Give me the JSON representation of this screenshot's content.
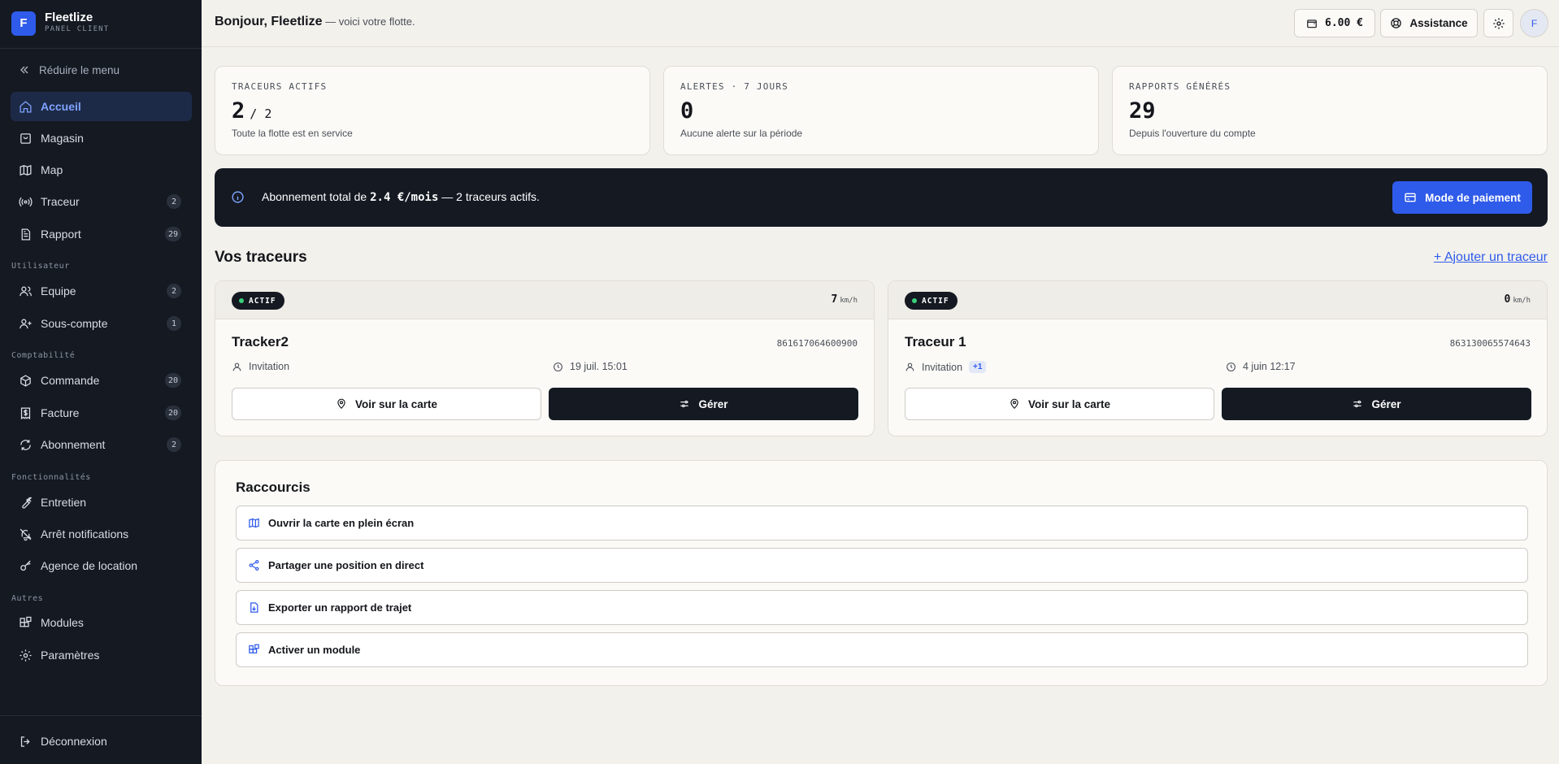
{
  "brand": {
    "logo_letter": "F",
    "name": "Fleetlize",
    "subtitle": "PANEL CLIENT"
  },
  "sidebar": {
    "collapse_label": "Réduire le menu",
    "main_items": [
      {
        "label": "Accueil",
        "icon": "home-icon",
        "active": true
      },
      {
        "label": "Magasin",
        "icon": "shopping-bag-icon"
      },
      {
        "label": "Map",
        "icon": "map-icon"
      },
      {
        "label": "Traceur",
        "icon": "radio-signal-icon",
        "badge": "2"
      },
      {
        "label": "Rapport",
        "icon": "file-text-icon",
        "badge": "29"
      }
    ],
    "sections": {
      "utilisateur": "Utilisateur",
      "comptabilite": "Comptabilité",
      "fonctionnalites": "Fonctionnalités",
      "autres": "Autres"
    },
    "user_items": [
      {
        "label": "Equipe",
        "icon": "users-icon",
        "badge": "2"
      },
      {
        "label": "Sous-compte",
        "icon": "user-plus-icon",
        "badge": "1"
      }
    ],
    "accounting_items": [
      {
        "label": "Commande",
        "icon": "package-icon",
        "badge": "20"
      },
      {
        "label": "Facture",
        "icon": "receipt-icon",
        "badge": "20"
      },
      {
        "label": "Abonnement",
        "icon": "refresh-icon",
        "badge": "2"
      }
    ],
    "feature_items": [
      {
        "label": "Entretien",
        "icon": "wrench-icon"
      },
      {
        "label": "Arrêt notifications",
        "icon": "bell-off-icon"
      },
      {
        "label": "Agence de location",
        "icon": "key-icon"
      }
    ],
    "other_items": [
      {
        "label": "Modules",
        "icon": "blocks-icon"
      },
      {
        "label": "Paramètres",
        "icon": "settings-icon"
      }
    ],
    "logout_label": "Déconnexion"
  },
  "header": {
    "greeting": "Bonjour, Fleetlize",
    "greeting_sub": " — voici votre flotte.",
    "balance": "6.00 €",
    "assistance_label": "Assistance",
    "avatar_letter": "F"
  },
  "stats": [
    {
      "label": "TRACEURS ACTIFS",
      "value": "2",
      "suffix": "/ 2",
      "desc": "Toute la flotte est en service"
    },
    {
      "label": "ALERTES · 7 JOURS",
      "value": "0",
      "suffix": "",
      "desc": "Aucune alerte sur la période"
    },
    {
      "label": "RAPPORTS GÉNÉRÉS",
      "value": "29",
      "suffix": "",
      "desc": "Depuis l'ouverture du compte"
    }
  ],
  "banner": {
    "text_before": "Abonnement total de ",
    "price": "2.4 €/mois",
    "text_after": " — 2 traceurs actifs.",
    "button_label": "Mode de paiement"
  },
  "trackers_section": {
    "title": "Vos traceurs",
    "add_label": "+ Ajouter un traceur"
  },
  "trackers": [
    {
      "status": "ACTIF",
      "speed": "7",
      "speed_unit": "km/h",
      "name": "Tracker2",
      "imei": "861617064600900",
      "user": "Invitation",
      "extra": "",
      "time": "19 juil. 15:01",
      "view_label": "Voir sur la carte",
      "manage_label": "Gérer"
    },
    {
      "status": "ACTIF",
      "speed": "0",
      "speed_unit": "km/h",
      "name": "Traceur 1",
      "imei": "863130065574643",
      "user": "Invitation",
      "extra": "+1",
      "time": "4 juin 12:17",
      "view_label": "Voir sur la carte",
      "manage_label": "Gérer"
    }
  ],
  "shortcuts": {
    "title": "Raccourcis",
    "items": [
      {
        "label": "Ouvrir la carte en plein écran",
        "icon": "map-icon"
      },
      {
        "label": "Partager une position en direct",
        "icon": "share-icon"
      },
      {
        "label": "Exporter un rapport de trajet",
        "icon": "file-export-icon"
      },
      {
        "label": "Activer un module",
        "icon": "blocks-icon"
      }
    ]
  },
  "colors": {
    "accent": "#2f5bea",
    "sidebar_bg": "#141922",
    "page_bg": "#f3f1ec",
    "status_dot": "#3ad07a"
  }
}
